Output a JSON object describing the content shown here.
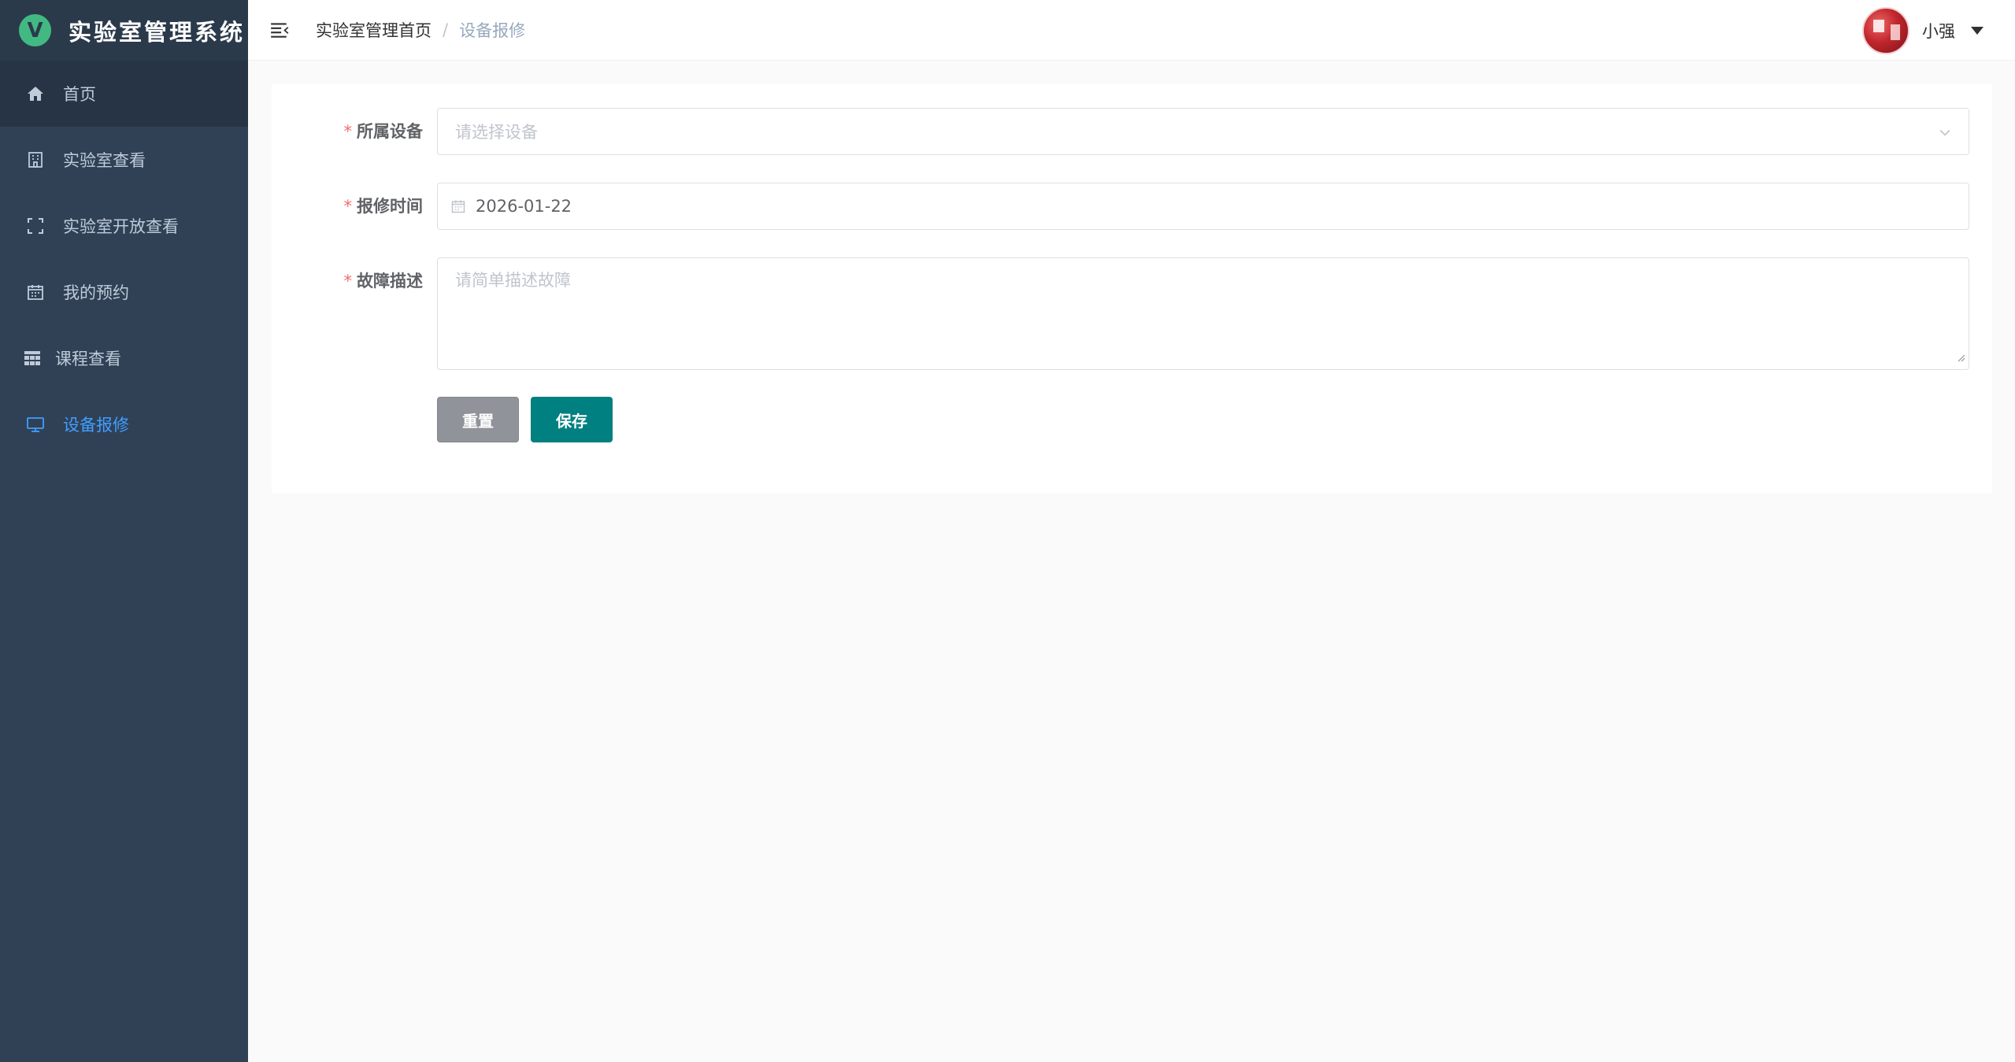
{
  "app": {
    "title": "实验室管理系统",
    "logo_letter": "V"
  },
  "sidebar": {
    "items": [
      {
        "label": "首页",
        "icon": "home-icon"
      },
      {
        "label": "实验室查看",
        "icon": "building-icon"
      },
      {
        "label": "实验室开放查看",
        "icon": "fullscreen-icon"
      },
      {
        "label": "我的预约",
        "icon": "calendar-icon"
      },
      {
        "label": "课程查看",
        "icon": "grid-icon"
      },
      {
        "label": "设备报修",
        "icon": "monitor-icon"
      }
    ],
    "active_index": 5
  },
  "header": {
    "breadcrumb": {
      "home": "实验室管理首页",
      "separator": "/",
      "current": "设备报修"
    },
    "user": {
      "name": "小强"
    }
  },
  "form": {
    "device": {
      "label": "所属设备",
      "required": "*",
      "placeholder": "请选择设备"
    },
    "time": {
      "label": "报修时间",
      "required": "*",
      "value": "2026-01-22"
    },
    "desc": {
      "label": "故障描述",
      "required": "*",
      "placeholder": "请简单描述故障"
    },
    "reset_label": "重置",
    "save_label": "保存"
  },
  "colors": {
    "sidebar_bg": "#304156",
    "active": "#409eff",
    "save_button": "#008080",
    "reset_button": "#909399",
    "required_star": "#f56c6c"
  }
}
